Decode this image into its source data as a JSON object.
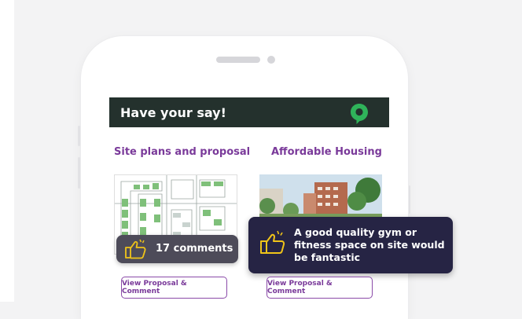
{
  "header": {
    "title": "Have your say!"
  },
  "columns": [
    {
      "title": "Site plans and proposal",
      "button_label": "View Proposal & Comment"
    },
    {
      "title": "Affordable Housing",
      "button_label": "View Proposal & Comment"
    }
  ],
  "comment_badge": {
    "text": "17 comments"
  },
  "quote": {
    "text": "A good quality gym or fitness space on site would be fantastic"
  },
  "colors": {
    "header_bg": "#24312d",
    "accent_purple": "#7a3a9a",
    "logo_green": "#2fb35a",
    "badge_bg": "#4d4b59",
    "quote_bg": "#262444",
    "thumb_gold": "#f0c419"
  },
  "icons": [
    "logo-pin-icon",
    "thumbs-up-icon"
  ]
}
